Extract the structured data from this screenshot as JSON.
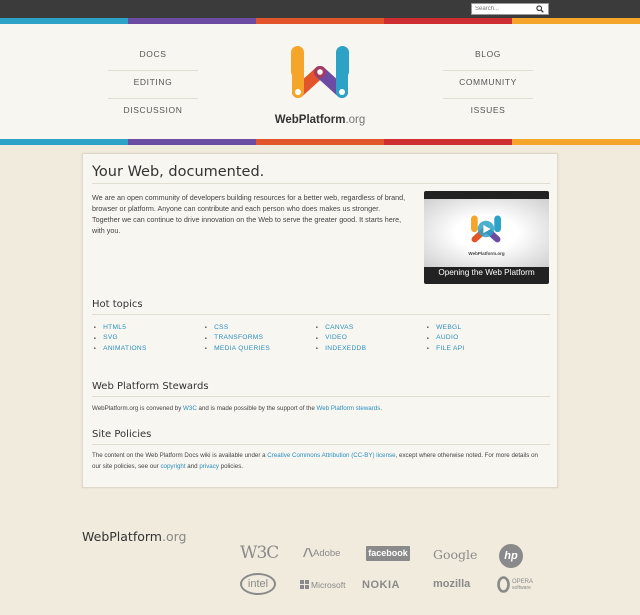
{
  "search": {
    "placeholder": "Search..."
  },
  "nav": {
    "left": [
      "DOCS",
      "EDITING",
      "DISCUSSION"
    ],
    "right": [
      "BLOG",
      "COMMUNITY",
      "ISSUES"
    ]
  },
  "brand": {
    "name": "WebPlatform",
    "tld": ".org"
  },
  "colors": {
    "stripe": [
      "#2ba2c6",
      "#6c4ba3",
      "#e2552a",
      "#ce2d31",
      "#f5a52a"
    ]
  },
  "main": {
    "title": "Your Web, documented.",
    "intro": "We are an open community of developers building resources for a better web, regardless of brand, browser or platform. Anyone can contribute and each person who does makes us stronger. Together we can continue to drive innovation on the Web to serve the greater good. It starts here, with you.",
    "video_caption": "Opening the Web Platform",
    "video_brand": "WebPlatform.org",
    "hot_topics": {
      "heading": "Hot topics",
      "columns": [
        [
          "HTML5",
          "SVG",
          "ANIMATIONS"
        ],
        [
          "CSS",
          "TRANSFORMS",
          "MEDIA QUERIES"
        ],
        [
          "CANVAS",
          "VIDEO",
          "INDEXEDDB"
        ],
        [
          "WEBGL",
          "AUDIO",
          "FILE API"
        ]
      ]
    },
    "stewards": {
      "heading": "Web Platform Stewards",
      "text1": "WebPlatform.org is convened by ",
      "link1": "W3C",
      "text2": " and is made possible by the support of the ",
      "link2": "Web Platform stewards",
      "text3": "."
    },
    "policies": {
      "heading": "Site Policies",
      "text1": "The content on the Web Platform Docs wiki is available under a ",
      "link1": "Creative Commons Attribution (CC-BY) license",
      "text2": ", except where otherwise noted. For more details on our site policies, see our ",
      "link2": "copyright",
      "text3": " and ",
      "link3": "privacy",
      "text4": " policies."
    }
  },
  "footer": {
    "brand": "WebPlatform",
    "tld": ".org",
    "sponsors": [
      "W3C",
      "Adobe",
      "facebook",
      "Google",
      "hp",
      "intel",
      "Microsoft",
      "NOKIA",
      "mozilla",
      "OPERA",
      "software"
    ]
  }
}
